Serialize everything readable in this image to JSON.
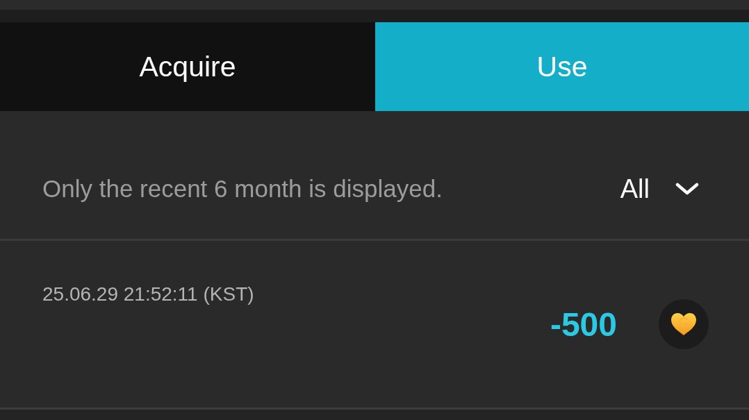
{
  "tabs": [
    {
      "label": "Acquire",
      "selected": false
    },
    {
      "label": "Use",
      "selected": true
    }
  ],
  "filter": {
    "notice": "Only the recent 6 month is displayed.",
    "dropdown": {
      "value": "All"
    }
  },
  "history": [
    {
      "datetime": "25.06.29 21:52:11 (KST)",
      "amount": "-500"
    }
  ]
}
